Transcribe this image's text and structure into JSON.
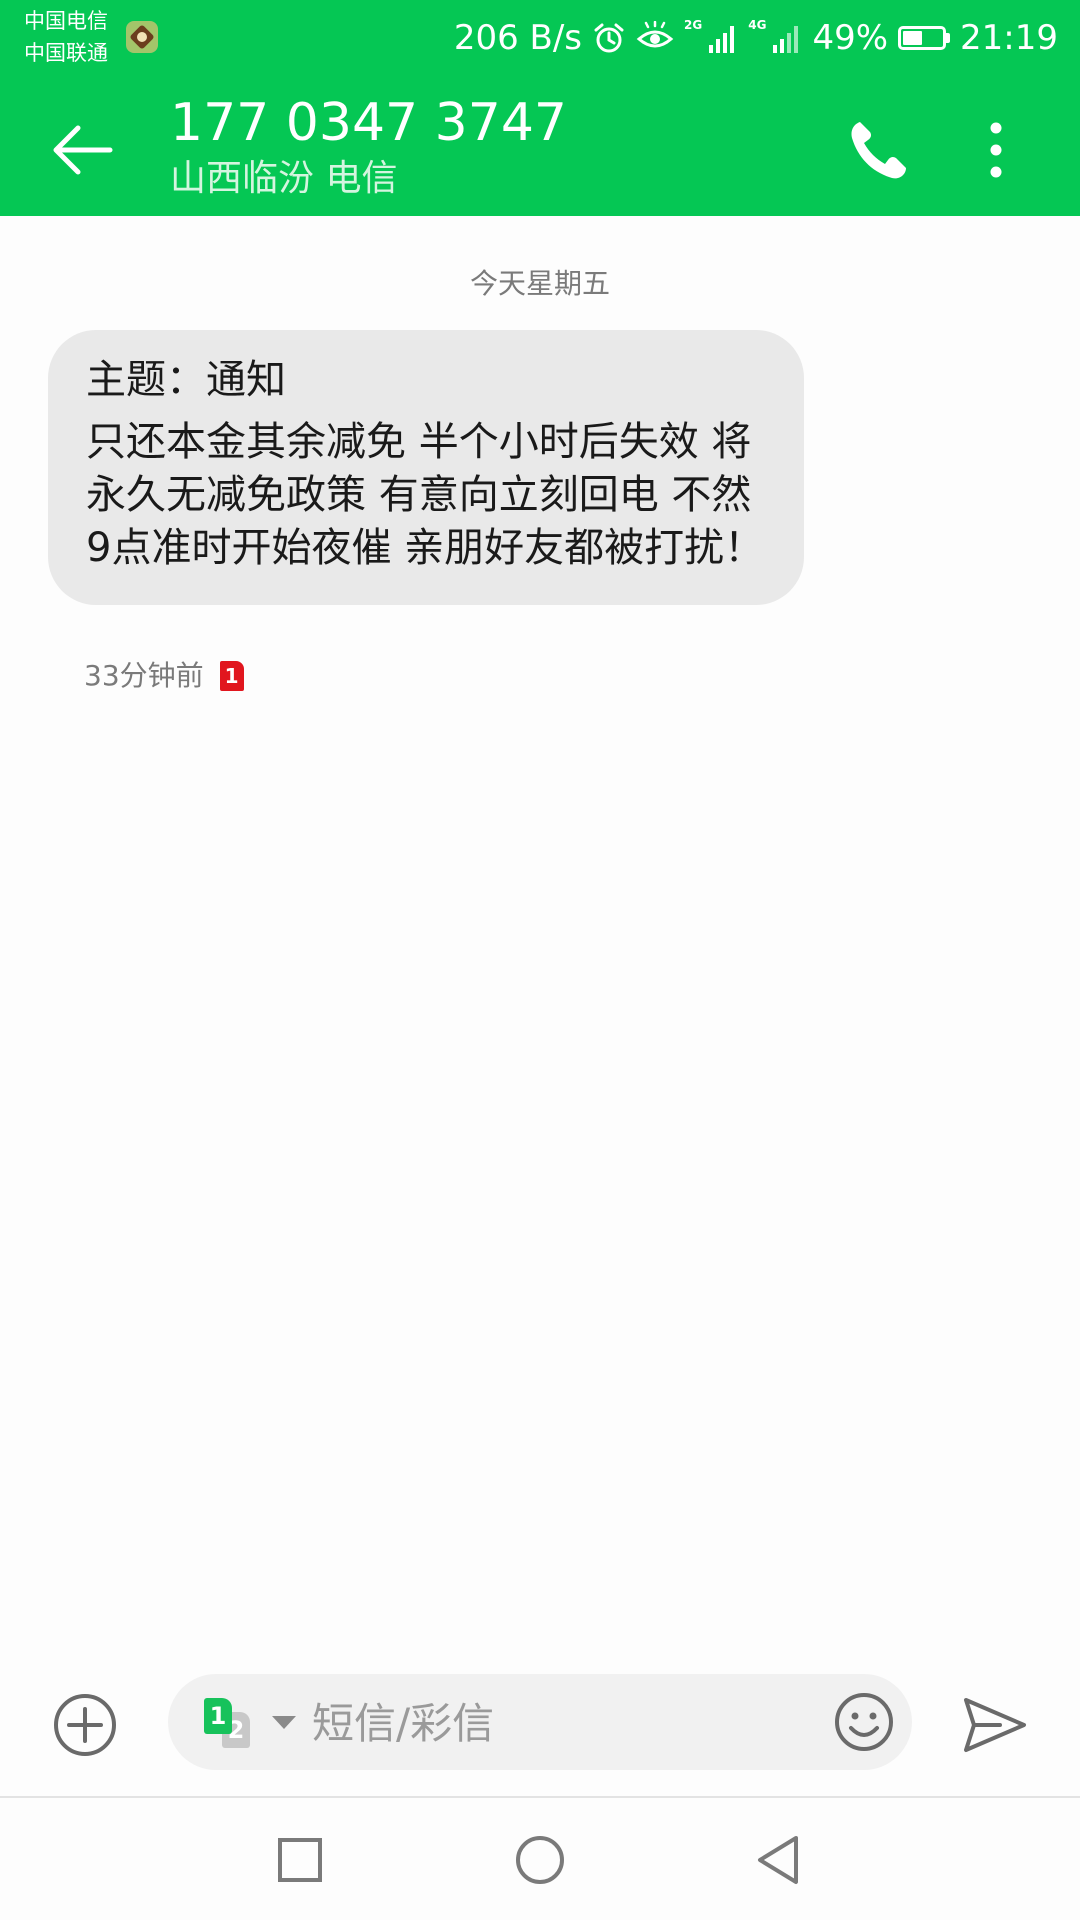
{
  "status_bar": {
    "carrier_1": "中国电信",
    "carrier_2": "中国联通",
    "network_speed": "206 B/s",
    "network_type_1": "2G",
    "network_type_2": "4G",
    "battery": "49%",
    "time": "21:19"
  },
  "app_bar": {
    "title": "177 0347 3747",
    "subtitle": "山西临汾 电信"
  },
  "conversation": {
    "date_separator": "今天星期五",
    "messages": [
      {
        "subject": "主题：通知",
        "body": "只还本金其余减免 半个小时后失效 将永久无减免政策 有意向立刻回电 不然9点准时开始夜催 亲朋好友都被打扰！",
        "time": "33分钟前",
        "sim": "1"
      }
    ]
  },
  "composer": {
    "sim_primary": "1",
    "sim_secondary": "2",
    "placeholder": "短信/彩信"
  },
  "colors": {
    "brand_green": "#05c754",
    "bubble_bg": "#e9e9e9",
    "sim1_red": "#e1161e",
    "sim1_green": "#17c25b"
  }
}
